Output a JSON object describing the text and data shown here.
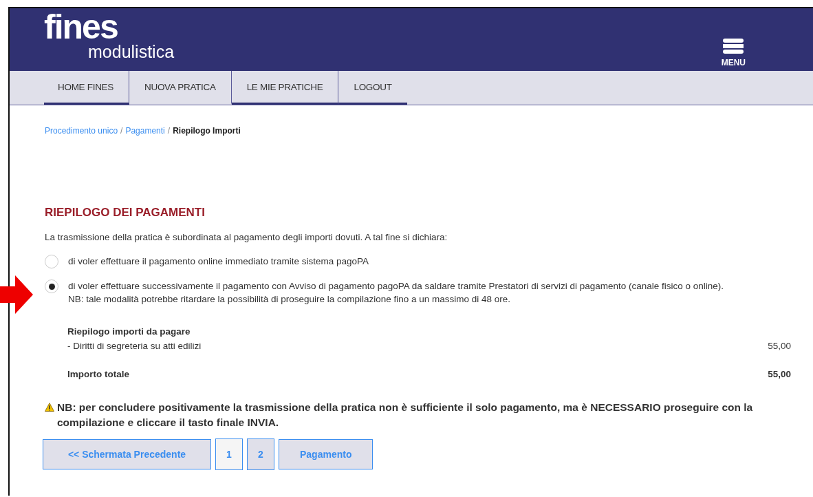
{
  "header": {
    "logo_main": "fines",
    "logo_sub": "modulistica",
    "menu_label": "MENU"
  },
  "nav": [
    {
      "label": "HOME FINES",
      "underlined": true
    },
    {
      "label": "NUOVA PRATICA",
      "underlined": false
    },
    {
      "label": "LE MIE PRATICHE",
      "underlined": true
    },
    {
      "label": "LOGOUT",
      "underlined": true
    }
  ],
  "breadcrumb": [
    {
      "label": "Procedimento unico",
      "link": true
    },
    {
      "label": "Pagamenti",
      "link": true
    },
    {
      "label": "Riepilogo Importi",
      "link": false
    }
  ],
  "breadcrumb_separator": "/",
  "title": "RIEPILOGO DEI PAGAMENTI",
  "intro": "La trasmissione della pratica è subordinata al pagamento degli importi dovuti. A tal fine si dichiara:",
  "options": [
    {
      "label": "di voler effettuare il pagamento online immediato tramite sistema pagoPA",
      "selected": false
    },
    {
      "label": "di voler effettuare successivamente il pagamento con Avviso di pagamento pagoPA da saldare tramite Prestatori di servizi di pagamento (canale fisico o online). NB: tale modalità potrebbe ritardare la possibilità di proseguire la compilazione fino a un massimo di 48 ore.",
      "selected": true
    }
  ],
  "summary": {
    "heading": "Riepilogo importi da pagare",
    "items": [
      {
        "label": "- Diritti di segreteria su atti edilizi",
        "amount": "55,00"
      }
    ],
    "total_label": "Importo totale",
    "total_amount": "55,00"
  },
  "note": "NB: per concludere positivamente la trasmissione della pratica non è sufficiente il solo pagamento, ma è NECESSARIO proseguire con la compilazione e cliccare il tasto finale INVIA.",
  "buttons": [
    {
      "label": "<< Schermata Precedente",
      "kind": "action"
    },
    {
      "label": "1",
      "kind": "page",
      "selected": true
    },
    {
      "label": "2",
      "kind": "page",
      "selected": false
    },
    {
      "label": "Pagamento",
      "kind": "action"
    }
  ]
}
